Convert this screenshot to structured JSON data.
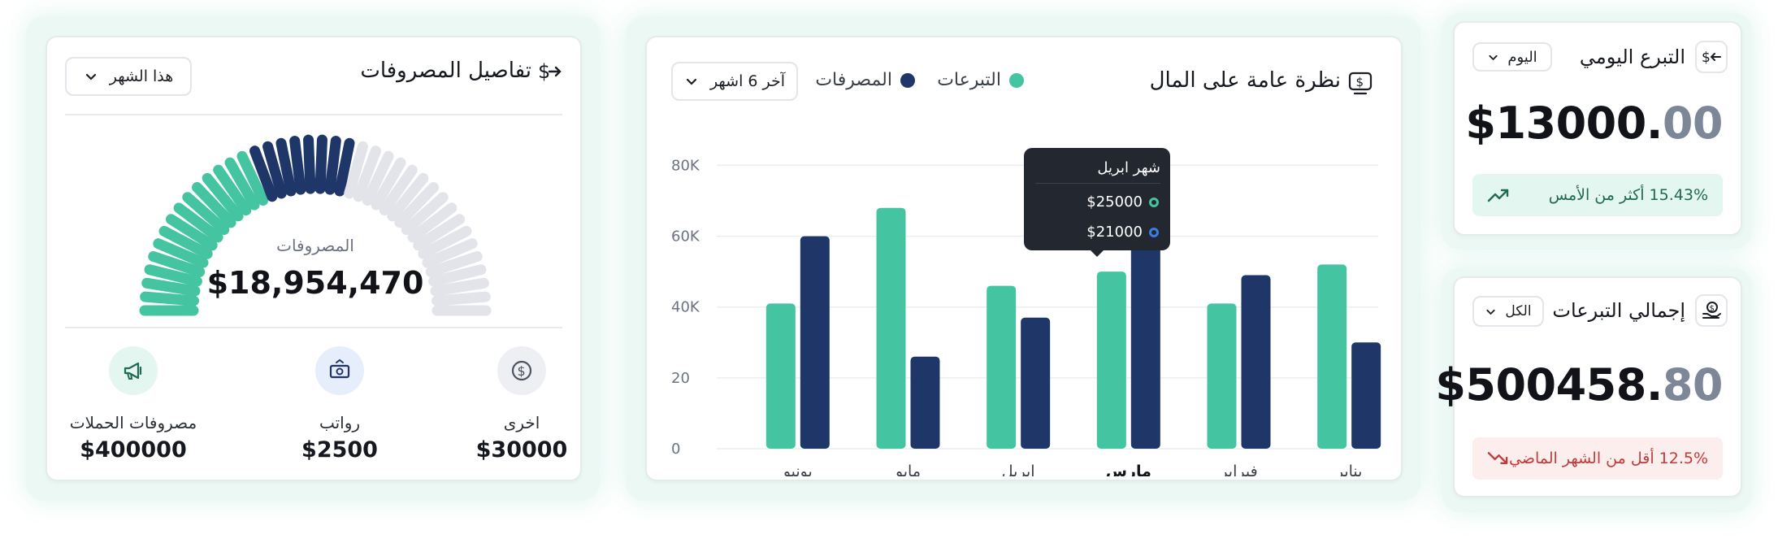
{
  "colors": {
    "green": "#44c4a1",
    "navy": "#1f3668",
    "grey": "#e2e4e9",
    "up_bg": "#e3f6ef",
    "down_bg": "#fdeeee"
  },
  "daily_donation": {
    "title": "التبرع اليومي",
    "icon": "dollar-exchange-icon",
    "dropdown": "اليوم",
    "amount_int": "$13000.",
    "amount_dec": "00",
    "change_text": "15.43% أكثر من الأمس",
    "trend_icon": "trend-up-icon"
  },
  "total_donations": {
    "title": "إجمالي التبرعات",
    "icon": "coins-hand-icon",
    "dropdown": "الكل",
    "amount_int": "$500458.",
    "amount_dec": "80",
    "change_text": "12.5% أقل من الشهر الماضي",
    "trend_icon": "trend-down-icon"
  },
  "finance_overview": {
    "title": "نظرة عامة على المال",
    "icon": "money-icon",
    "dropdown": "آخر 6 اشهر",
    "legend": [
      {
        "label": "التبرعات",
        "color": "#44c4a1"
      },
      {
        "label": "المصرفات",
        "color": "#1f3668"
      }
    ],
    "tooltip": {
      "title": "شهر ابريل",
      "rows": [
        {
          "value": "$25000",
          "color": "#44c4a1"
        },
        {
          "value": "$21000",
          "color": "#3a7de0"
        }
      ]
    }
  },
  "chart_data": {
    "type": "bar",
    "categories": [
      "يناير",
      "فبراير",
      "مارس",
      "ابريل",
      "مايو",
      "يونيو"
    ],
    "highlighted_category": "مارس",
    "series": [
      {
        "name": "التبرعات",
        "values": [
          52000,
          41000,
          50000,
          46000,
          68000,
          41000
        ]
      },
      {
        "name": "المصرفات",
        "values": [
          30000,
          49000,
          59000,
          37000,
          26000,
          60000
        ]
      }
    ],
    "y_ticks": [
      "0",
      "20",
      "40K",
      "60K",
      "80K"
    ],
    "ylim": [
      0,
      84000
    ],
    "grid": true,
    "x_direction": "right-to-left"
  },
  "expense_details": {
    "title": "تفاصيل المصروفات",
    "icon": "dollar-arrow-icon",
    "dropdown": "هذا الشهر",
    "gauge_label": "المصروفات",
    "gauge_value": "$18,954,470",
    "gauge_segments": {
      "total": 40,
      "green": 15,
      "navy": 8
    },
    "stats": [
      {
        "label": "مصروفات الحملات",
        "value": "$400000",
        "icon": "megaphone-icon",
        "bg": "#e3f6ef"
      },
      {
        "label": "رواتب",
        "value": "$2500",
        "icon": "cash-icon",
        "bg": "#e6eefb"
      },
      {
        "label": "اخرى",
        "value": "$30000",
        "icon": "dollar-circle-icon",
        "bg": "#eeeff2"
      }
    ]
  }
}
